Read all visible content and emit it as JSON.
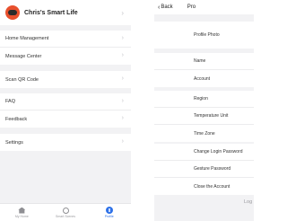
{
  "left_screen": {
    "profile": {
      "name": "Chris's Smart Life"
    },
    "group1": [
      "Home Management",
      "Message Center"
    ],
    "group2": [
      "Scan QR Code"
    ],
    "group3": [
      "FAQ",
      "Feedback"
    ],
    "group4": [
      "Settings"
    ],
    "tabbar": {
      "tabs": [
        {
          "label": "My Home",
          "icon": "home-icon"
        },
        {
          "label": "Smart Scenes",
          "icon": "scenes-icon"
        },
        {
          "label": "Profile",
          "icon": "profile-icon",
          "active": true
        }
      ]
    }
  },
  "right_screen": {
    "nav": {
      "back_label": "Back",
      "title": "Pro"
    },
    "group1": [
      "Profile Photo"
    ],
    "group2": [
      "Name",
      "Account"
    ],
    "group3": [
      "Region",
      "Temperature Unit",
      "Time Zone"
    ],
    "group4": [
      "Change Login Password",
      "Gesture Password",
      "Close the Account"
    ],
    "logout_label": "Log"
  },
  "colors": {
    "accent": "#2f72e8",
    "avatar": "#e8502d",
    "background": "#f2f2f4"
  }
}
